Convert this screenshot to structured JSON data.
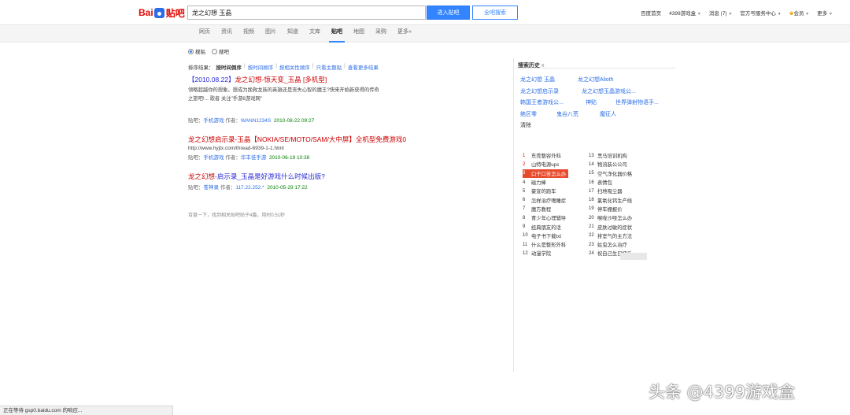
{
  "header": {
    "logo_text_b": "Bai",
    "logo_text_tb": "贴吧",
    "search_value": "龙之幻想 玉晶",
    "btn_enter": "进入贴吧",
    "btn_all": "全吧搜索",
    "links": [
      "百度首页",
      "4399游戏盒",
      "消息",
      "(7)",
      "官方号服务中心",
      "会员",
      "更多"
    ]
  },
  "nav": {
    "items": [
      "网页",
      "资讯",
      "视频",
      "图片",
      "知道",
      "文库",
      "贴吧",
      "地图",
      "采购",
      "更多»"
    ]
  },
  "filters": {
    "radio_post": "搜贴",
    "radio_bar": "搜吧"
  },
  "sort": {
    "label": "排序结果：",
    "current": "按时间倒序",
    "asc": "按时间顺序",
    "relevance": "按相关性顺序",
    "topic": "只看主题贴",
    "more": "查看更多结果"
  },
  "results": [
    {
      "title_prefix": "【2010.08.22】",
      "title_main": "龙之幻想-惊天变_玉晶 [多机型]",
      "desc1": "领略超越你的想象。想成为挽救龙族的英雄还是丧失心智的魔王?快来开始新获得的传奇",
      "desc2": "之旅吧!... 歌者 关注\"手游8游戏网\"",
      "meta_bar_label": "贴吧：",
      "meta_bar": "手机游戏",
      "meta_author_label": "作者：",
      "meta_author": "WANN1234S",
      "meta_time": "2010-08-22 09:27"
    },
    {
      "title_red": "龙之幻想",
      "title_main": "启示录-玉晶【NOKIA/SE/MOTO/SAM/大中屏】全机型免费游戏0",
      "url": "http://www.hyjtx.com/thread-6939-1-1.html",
      "meta_bar_label": "贴吧：",
      "meta_bar": "手机游戏",
      "meta_author_label": "作者：",
      "meta_author": "华丰佳手游",
      "meta_time": "2010-06-19 10:38"
    },
    {
      "title_red": "龙之幻想",
      "title_main": "-启示录_玉晶是好游戏什么时候出版?",
      "meta_bar_label": "贴吧：",
      "meta_bar": "苍神录",
      "meta_author_label": "作者：",
      "meta_author": "117.22.252.*",
      "meta_time": "2010-05-29 17:22"
    }
  ],
  "footnote": "百度一下，找到相关贴吧贴子4篇，用时0.51秒",
  "history": {
    "title": "搜索历史",
    "close": "x",
    "rows": [
      [
        "龙之幻想 玉晶",
        "龙之幻想Alioth"
      ],
      [
        "龙之幻想启示录",
        "龙之幻想玉晶游戏公..."
      ],
      [
        "韩国王者游戏公...",
        "神贴",
        "世界弹射物语手..."
      ],
      [
        "绝区零",
        "鬼谷八荒",
        "魔征人"
      ],
      [
        "清除"
      ]
    ]
  },
  "hot": {
    "left": [
      {
        "n": "1",
        "t": "东莞整容外科"
      },
      {
        "n": "2",
        "t": "山特电源ups"
      },
      {
        "n": "3",
        "t": "口干口苦怎么办"
      },
      {
        "n": "4",
        "t": "磁力棒"
      },
      {
        "n": "5",
        "t": "豪宣的跑车"
      },
      {
        "n": "6",
        "t": "怎样治疗嗜睡症"
      },
      {
        "n": "7",
        "t": "魔方教程"
      },
      {
        "n": "8",
        "t": "青少年心理辅导"
      },
      {
        "n": "9",
        "t": "经典朋友的话"
      },
      {
        "n": "10",
        "t": "电子书下载txt"
      },
      {
        "n": "11",
        "t": "什么是整形外科"
      },
      {
        "n": "12",
        "t": "动漫学院"
      }
    ],
    "right": [
      {
        "n": "13",
        "t": "黑马培训机构"
      },
      {
        "n": "14",
        "t": "物流装公公司"
      },
      {
        "n": "15",
        "t": "空气净化器价格"
      },
      {
        "n": "16",
        "t": "表情包"
      },
      {
        "n": "17",
        "t": "扫地吸尘器"
      },
      {
        "n": "18",
        "t": "氯氧化钙生产线"
      },
      {
        "n": "19",
        "t": "停车棚报价"
      },
      {
        "n": "20",
        "t": "喉咙沙哑怎么办"
      },
      {
        "n": "21",
        "t": "皮肤过敏的症状"
      },
      {
        "n": "22",
        "t": "排室气的主方法"
      },
      {
        "n": "23",
        "t": "蛀虫怎么治疗"
      },
      {
        "n": "24",
        "t": "祝自己生日快乐"
      }
    ],
    "highlight_index": 2
  },
  "status_text": "正在等待 gsp0.baidu.com 的响应...",
  "watermark": "头条 @4399游戏盒"
}
